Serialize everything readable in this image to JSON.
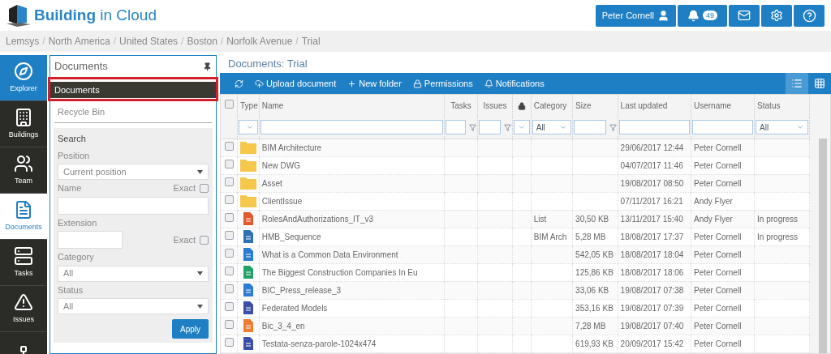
{
  "header": {
    "logo_text": "**Building** in Cloud",
    "user_button": "Peter Cornell",
    "notification_count": "49"
  },
  "breadcrumb": {
    "separator": "/",
    "items": [
      "Lemsys",
      "North America",
      "United States",
      "Boston",
      "Norfolk Avenue",
      "Trial"
    ]
  },
  "nav": [
    {
      "label": "Explorer",
      "kind": "module"
    },
    {
      "label": "Buildings",
      "selected": false,
      "kind": "item"
    },
    {
      "label": "Team",
      "selected": false,
      "kind": "item"
    },
    {
      "label": "Documents",
      "selected": true,
      "kind": "item"
    },
    {
      "label": "Tasks",
      "selected": false,
      "kind": "item"
    },
    {
      "label": "Issues",
      "selected": false,
      "kind": "item"
    },
    {
      "selected": false,
      "kind": "item"
    }
  ],
  "panel": {
    "title": "Documents",
    "tree": [
      {
        "label": "Documents",
        "selected": true,
        "highlighted": true
      },
      {
        "label": "Recycle Bin",
        "selected": false,
        "highlighted": false
      }
    ],
    "search": {
      "title": "Search",
      "position_label": "Position",
      "position_value": "Current position",
      "name_label": "Name",
      "name_exact_label": "Exact",
      "name_exact_checked": false,
      "extension_label": "Extension",
      "extension_exact_label": "Exact",
      "extension_exact_checked": false,
      "category_label": "Category",
      "category_value": "All",
      "status_label": "Status",
      "status_value": "All",
      "apply": "Apply"
    }
  },
  "content": {
    "title": "Documents: Trial",
    "toolbar": [
      "Upload document",
      "New folder",
      "Permissions",
      "Notifications"
    ],
    "view": [
      {
        "kind": "list",
        "selected": true
      },
      {
        "kind": "grid",
        "selected": false
      }
    ],
    "table": {
      "select_all_checked": false,
      "columns": [
        "Type",
        "Name",
        "Tasks",
        "Issues",
        "",
        "Category",
        "Size",
        "Last updated",
        "Username",
        "Status"
      ],
      "filters": [
        {
          "kind": "select"
        },
        {
          "kind": "text"
        },
        {
          "kind": "number"
        },
        {
          "kind": "number"
        },
        {
          "kind": "select"
        },
        {
          "kind": "select",
          "value": "All"
        },
        {
          "kind": "number"
        },
        {
          "kind": "text"
        },
        {
          "kind": "text"
        },
        {
          "kind": "select",
          "value": "All"
        }
      ],
      "rows": [
        {
          "checked": false,
          "kind": "folder",
          "name": "BIM Architecture",
          "category": "",
          "size": "",
          "updated": "29/06/2017 12:44",
          "username": "Peter Cornell",
          "status": ""
        },
        {
          "checked": false,
          "kind": "folder",
          "name": "New DWG",
          "category": "",
          "size": "",
          "updated": "04/07/2017 11:46",
          "username": "Peter Cornell",
          "status": ""
        },
        {
          "checked": false,
          "kind": "folder",
          "name": "Asset",
          "category": "",
          "size": "",
          "updated": "19/08/2017 08:50",
          "username": "Peter Cornell",
          "status": ""
        },
        {
          "checked": false,
          "kind": "folder",
          "name": "ClientIssue",
          "category": "",
          "size": "",
          "updated": "07/11/2017 16:21",
          "username": "Andy Flyer",
          "status": ""
        },
        {
          "checked": false,
          "kind": "pdf",
          "name": "RolesAndAuthorizations_IT_v3",
          "category": "List",
          "size": "30,50 KB",
          "updated": "13/11/2017 15:40",
          "username": "Andy Flyer",
          "status": "In progress"
        },
        {
          "checked": false,
          "kind": "rvt",
          "name": "HMB_Sequence",
          "category": "BIM Arch",
          "size": "5,28 MB",
          "updated": "18/08/2017 17:37",
          "username": "Peter Cornell",
          "status": "In progress"
        },
        {
          "checked": false,
          "kind": "word",
          "name": "What is a Common Data Environment",
          "category": "",
          "size": "542,05 KB",
          "updated": "18/08/2017 18:04",
          "username": "Peter Cornell",
          "status": ""
        },
        {
          "checked": false,
          "kind": "excel",
          "name": "The Biggest Construction Companies In Eu",
          "category": "",
          "size": "125,86 KB",
          "updated": "18/08/2017 18:06",
          "username": "Peter Cornell",
          "status": ""
        },
        {
          "checked": false,
          "kind": "word",
          "name": "BIC_Press_release_3",
          "category": "",
          "size": "33,06 KB",
          "updated": "19/08/2017 07:38",
          "username": "Peter Cornell",
          "status": ""
        },
        {
          "checked": false,
          "kind": "png",
          "name": "Federated Models",
          "category": "",
          "size": "353,16 KB",
          "updated": "19/08/2017 07:39",
          "username": "Peter Cornell",
          "status": ""
        },
        {
          "checked": false,
          "kind": "ppt",
          "name": "Bic_3_4_en",
          "category": "",
          "size": "7,28 MB",
          "updated": "19/08/2017 07:40",
          "username": "Peter Cornell",
          "status": ""
        },
        {
          "checked": false,
          "kind": "png",
          "name": "Testata-senza-parole-1024x474",
          "category": "",
          "size": "619,93 KB",
          "updated": "20/09/2017 15:42",
          "username": "Peter Cornell",
          "status": ""
        }
      ]
    }
  }
}
